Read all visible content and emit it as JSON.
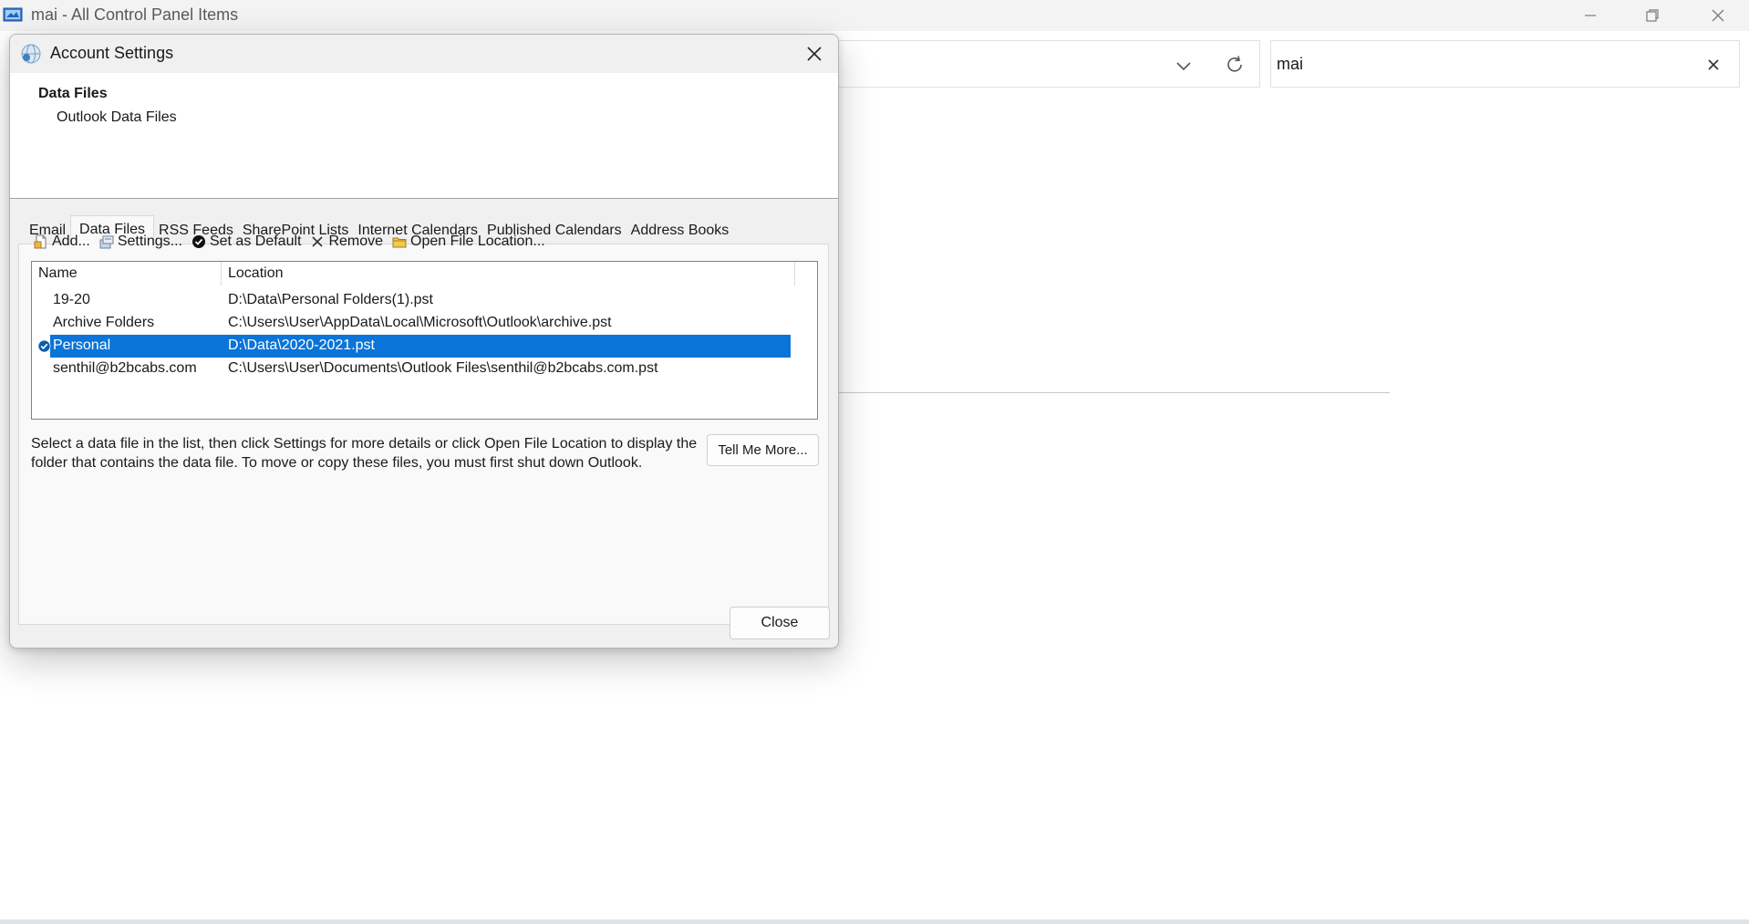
{
  "window": {
    "title": "mai - All Control Panel Items",
    "search_value": "mai"
  },
  "dialog": {
    "title": "Account Settings",
    "header_title": "Data Files",
    "header_subtitle": "Outlook Data Files",
    "tabs": [
      {
        "label": "Email",
        "active": false
      },
      {
        "label": "Data Files",
        "active": true
      },
      {
        "label": "RSS Feeds",
        "active": false
      },
      {
        "label": "SharePoint Lists",
        "active": false
      },
      {
        "label": "Internet Calendars",
        "active": false
      },
      {
        "label": "Published Calendars",
        "active": false
      },
      {
        "label": "Address Books",
        "active": false
      }
    ],
    "toolbar": {
      "add": "Add...",
      "settings": "Settings...",
      "set_default": "Set as Default",
      "remove": "Remove",
      "open_location": "Open File Location..."
    },
    "columns": {
      "name": "Name",
      "location": "Location"
    },
    "rows": [
      {
        "name": "19-20",
        "location": "D:\\Data\\Personal Folders(1).pst",
        "selected": false,
        "default": false
      },
      {
        "name": "Archive Folders",
        "location": "C:\\Users\\User\\AppData\\Local\\Microsoft\\Outlook\\archive.pst",
        "selected": false,
        "default": false
      },
      {
        "name": "Personal",
        "location": "D:\\Data\\2020-2021.pst",
        "selected": true,
        "default": true
      },
      {
        "name": "senthil@b2bcabs.com",
        "location": "C:\\Users\\User\\Documents\\Outlook Files\\senthil@b2bcabs.com.pst",
        "selected": false,
        "default": false
      }
    ],
    "hint_text": "Select a data file in the list, then click Settings for more details or click Open File Location to display the folder that contains the data file. To move or copy these files, you must first shut down Outlook.",
    "tell_me_more": "Tell Me More...",
    "close_label": "Close"
  },
  "colors": {
    "selection": "#0a74d8",
    "dialog_bg": "#f0f0f0"
  }
}
